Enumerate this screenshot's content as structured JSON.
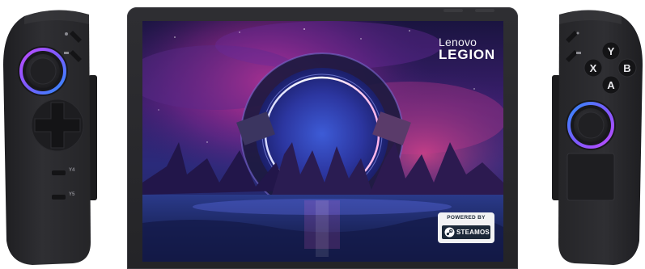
{
  "device": {
    "brand_line": "Lenovo",
    "product_line": "LEGION",
    "badge": {
      "top_text": "POWERED BY",
      "bottom_text": "STEAMOS"
    },
    "left_controller": {
      "small_labels": [
        "Y4",
        "Y5"
      ]
    },
    "right_controller": {
      "face_buttons": [
        "Y",
        "X",
        "B",
        "A"
      ]
    }
  },
  "colors": {
    "device_body": "#2b2b2f",
    "stick_ring_purple": "#b04cff",
    "stick_ring_blue": "#3f7dff",
    "badge_dark": "#1b2838"
  }
}
